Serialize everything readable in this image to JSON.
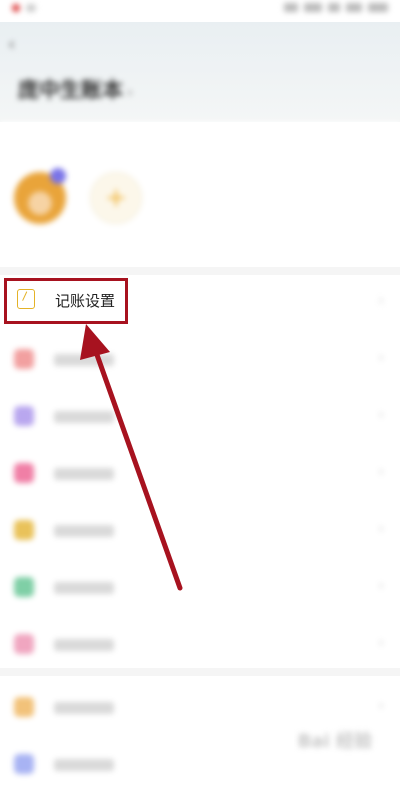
{
  "header": {
    "title": "庞中生账本",
    "back_icon": "back-arrow-icon"
  },
  "members": {
    "hint": "",
    "more_label": "",
    "avatar_label": "",
    "add_label": ""
  },
  "settings_row": {
    "label": "记账设置",
    "icon": "bookkeeping-settings-icon",
    "accent_color": "#e4b227"
  },
  "menu_icons": {
    "colors": [
      "#f2a0a0",
      "#b9a7ef",
      "#f07fa6",
      "#e9c25a",
      "#7fcfa6",
      "#f0a6c0",
      "#f2c27a",
      "#a8b3f3"
    ]
  },
  "highlight_color": "#a7121f",
  "watermark": {
    "text": "Bai 经验"
  }
}
